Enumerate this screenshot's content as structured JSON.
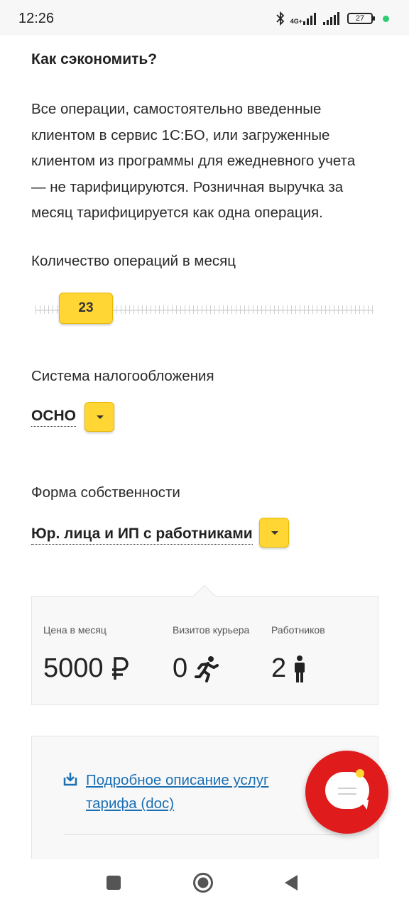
{
  "status_bar": {
    "time": "12:26",
    "network": "4G+",
    "battery": "27"
  },
  "colors": {
    "accent_yellow": "#ffd633",
    "chat_red": "#e01b1b",
    "link_blue": "#1b6fb3"
  },
  "heading": "Как сэкономить?",
  "paragraph": "Все операции, самостоятельно введенные клиентом в сервис 1С:БО, или загруженные клиентом из программы для ежедневного учета — не тарифицируются. Розничная выручка за месяц тарифицируется как одна операция.",
  "operations": {
    "label": "Количество операций в месяц",
    "value": "23"
  },
  "tax_system": {
    "label": "Система налогообложения",
    "value": "ОСНО"
  },
  "ownership": {
    "label": "Форма собственности",
    "value": "Юр. лица и ИП с работниками"
  },
  "summary": {
    "price_label": "Цена в месяц",
    "price_value": "5000",
    "price_icon": "ruble-icon",
    "courier_label": "Визитов курьера",
    "courier_value": "0",
    "courier_icon": "running-person-icon",
    "workers_label": "Работников",
    "workers_value": "2",
    "workers_icon": "person-icon"
  },
  "doc_link": {
    "text": "Подробное описание услуг тарифа (doc)",
    "icon": "download-icon"
  },
  "chat": {
    "icon": "chat-bubble-icon"
  },
  "nav": {
    "icons": [
      "recent-apps-icon",
      "home-icon",
      "back-icon"
    ]
  }
}
